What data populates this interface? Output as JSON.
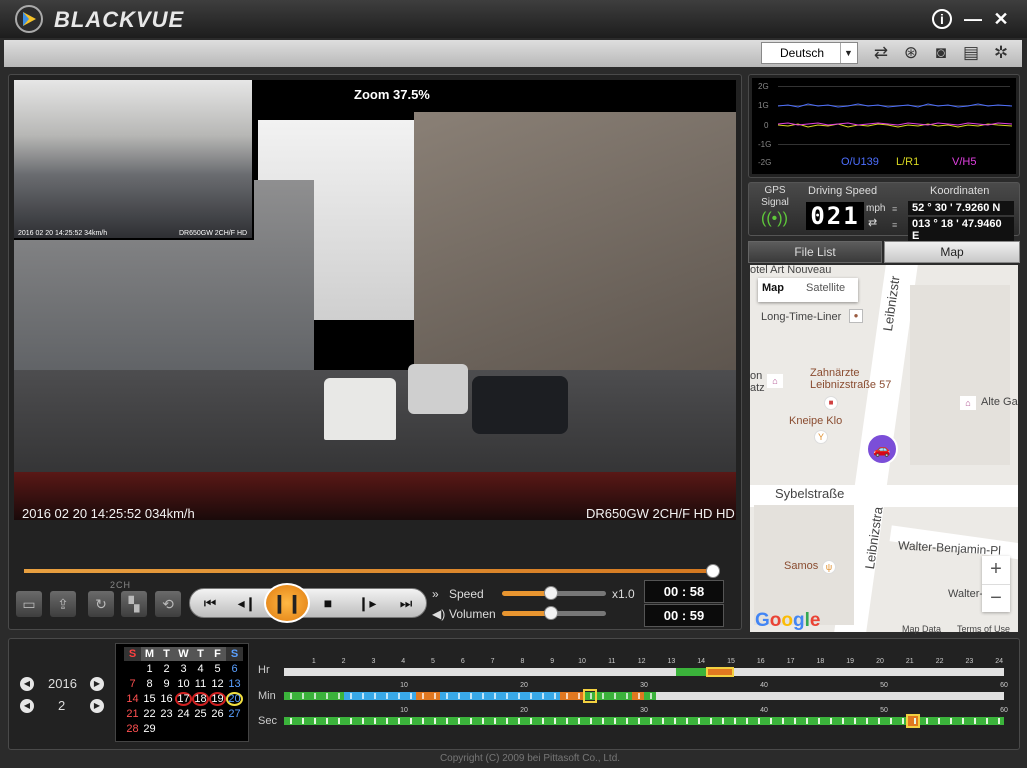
{
  "app": {
    "brand": "BLACKVUE",
    "info_label": "i",
    "minimize_label": "—",
    "close_label": "✕"
  },
  "toolbar": {
    "language": "Deutsch",
    "icons": [
      "refresh-icon",
      "compass-icon",
      "camera-icon",
      "print-icon",
      "settings-icon"
    ]
  },
  "video": {
    "zoom": "Zoom 37.5%",
    "timestamp": "2016 02 20  14:25:52     034km/h",
    "model": "DR650GW 2CH/F HD HD",
    "pip_timestamp": "2016 02 20  14:25:52  34km/h",
    "pip_model": "DR650GW 2CH/F HD"
  },
  "controls": {
    "ch_label": "2CH",
    "speed_label": "Speed",
    "volume_label": "Volumen",
    "speed_value": "x1.0",
    "time_current": "00 : 58",
    "time_total": "00 : 59",
    "seek_fraction": 0.99,
    "speed_fraction": 0.45,
    "volume_fraction": 0.45
  },
  "gsensor": {
    "labels": [
      "2G",
      "1G",
      "0",
      "-1G",
      "-2G"
    ],
    "legend": {
      "x": "O/U139",
      "y": "L/R1",
      "z": "V/H5"
    },
    "colors": {
      "x": "#4d6fff",
      "y": "#d8d820",
      "z": "#e040e0"
    }
  },
  "gps": {
    "signal_label": "GPS\nSignal",
    "driving_speed_label": "Driving Speed",
    "speed_digits": "021",
    "speed_unit": "mph",
    "coords_label": "Koordinaten",
    "lat": "52 ° 30 ' 7.9260 N",
    "lon": "013 ° 18 ' 47.9460 E"
  },
  "tabs": {
    "file_list": "File List",
    "map": "Map"
  },
  "map": {
    "map_label": "Map",
    "satellite_label": "Satellite",
    "labels": {
      "hotel": "otel Art Nouveau",
      "leibnizstr_top": "Leibnizstr",
      "long_time": "Long-Time-Liner",
      "zahnarzte": "Zahnärzte\nLeibnizstraße 57",
      "kneipe": "Kneipe Klo",
      "sybel": "Sybelstraße",
      "leibnizstr_bottom": "Leibnizstra",
      "walter1": "Walter-Benjamin-Pl",
      "samos": "Samos",
      "walter2": "Walter-",
      "alte": "Alte Ga",
      "on": "on\natz"
    },
    "google": "Google",
    "map_data": "Map Data",
    "terms": "Terms of Use"
  },
  "timeline": {
    "year": "2016",
    "month": "2",
    "hr_label": "Hr",
    "min_label": "Min",
    "sec_label": "Sec"
  },
  "calendar": {
    "headers": [
      "S",
      "M",
      "T",
      "W",
      "T",
      "F",
      "S"
    ],
    "rows": [
      [
        "",
        "",
        "",
        "",
        "",
        "",
        ""
      ],
      [
        "",
        "1",
        "2",
        "3",
        "4",
        "5",
        "6"
      ],
      [
        "7",
        "8",
        "9",
        "10",
        "11",
        "12",
        "13"
      ],
      [
        "14",
        "15",
        "16",
        "17",
        "18",
        "19",
        "20"
      ],
      [
        "21",
        "22",
        "23",
        "24",
        "25",
        "26",
        "27"
      ],
      [
        "28",
        "29",
        "",
        "",
        "",
        "",
        ""
      ]
    ],
    "recorded": [
      "17",
      "18",
      "19"
    ],
    "selected": "20"
  },
  "hr_ticks": [
    "1",
    "2",
    "3",
    "4",
    "5",
    "6",
    "7",
    "8",
    "9",
    "10",
    "11",
    "12",
    "13",
    "14",
    "15",
    "16",
    "17",
    "18",
    "19",
    "20",
    "21",
    "22",
    "23",
    "24"
  ],
  "min_ticks": [
    "10",
    "20",
    "30",
    "40",
    "50",
    "60"
  ],
  "sec_ticks": [
    "10",
    "20",
    "30",
    "40",
    "50",
    "60"
  ],
  "copyright": "Copyright (C) 2009 bei Pittasoft Co., Ltd."
}
